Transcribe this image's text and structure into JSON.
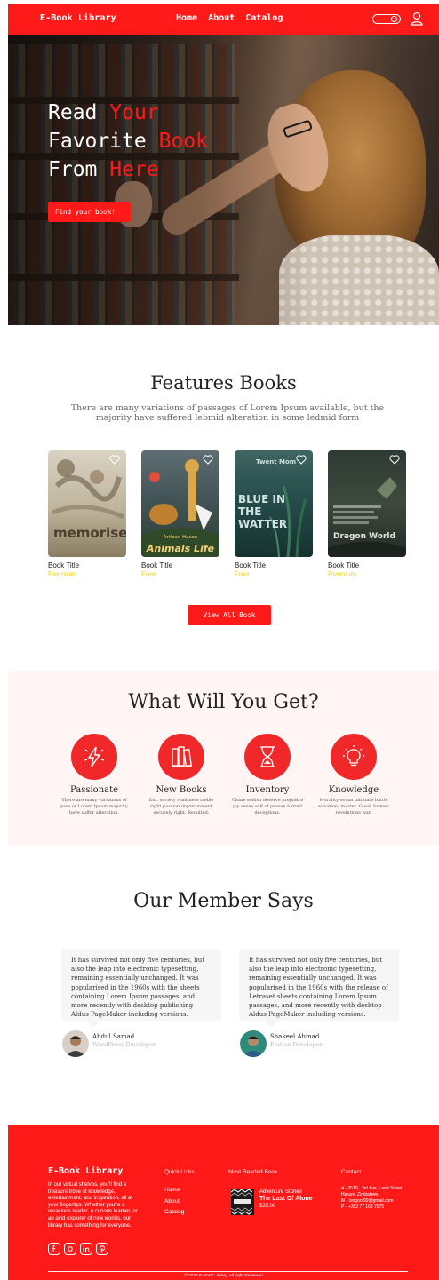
{
  "nav": {
    "brand": "E-Book Library",
    "links": [
      "Home",
      "About",
      "Catalog"
    ]
  },
  "hero": {
    "line1_a": "Read ",
    "line1_b": "Your",
    "line2_a": "Favorite ",
    "line2_b": "Book",
    "line3_a": "From ",
    "line3_b": "Here",
    "cta": "Find your book!"
  },
  "features": {
    "title": "Features Books",
    "subtitle": "There are many variations of passages of Lorem Ipsum available, but the majority have suffered lebmid alteration in some ledmid form",
    "books": [
      {
        "title": "Book Title",
        "price": "Premium",
        "cover_text": "memorise"
      },
      {
        "title": "Book Title",
        "price": "Free",
        "cover_author": "Arifean Hasan",
        "cover_text": "Animals Life"
      },
      {
        "title": "Book Title",
        "price": "Free",
        "cover_top": "Twent Mom",
        "cover_text": "BLUE IN THE WATTER"
      },
      {
        "title": "Book Title",
        "price": "Premium",
        "cover_text": "Dragon World"
      }
    ],
    "view_all": "View All Book"
  },
  "get": {
    "title": "What Will You Get?",
    "items": [
      {
        "name": "Passionate",
        "desc": "There are many variations of pass of Lorem Ipsum majority have suffer alteration.",
        "icon": "lightning-icon"
      },
      {
        "name": "New Books",
        "desc": "Dat. society readiness treble right passion imprisonment securely right. Reoulted.",
        "icon": "books-icon"
      },
      {
        "name": "Inventory",
        "desc": "Chase selfish deserve prejudice joy sense self of proven hatred deceptions.",
        "icon": "hourglass-icon"
      },
      {
        "name": "Knowledge",
        "desc": "Morality ocean ultimate battle salvation. master. Good. former. revelations war.",
        "icon": "lightbulb-icon"
      }
    ]
  },
  "members": {
    "title": "Our Member Says",
    "quotes": [
      {
        "text": "It has survived not only five centuries, but also the leap into electronic typesetting, remaining essentially unchanged. It was popularised in the 1960s with the sheets containing Lorem Ipsum passages, and more recently with desktop publishing Aldus PageMaker including versions.",
        "name": "Abdul Samad",
        "role": "WordPress Developer"
      },
      {
        "text": "It has survived not only five centuries, but also the leap into electronic typesetting, remaining essentially unchanged. It was popularised in the 1960s with the release of Letraset sheets containing Lorem Ipsum passages, and more recently with desktop Aldus PageMaker including versions.",
        "name": "Shakeel Ahmad",
        "role": "Flutter Developer"
      }
    ]
  },
  "footer": {
    "brand": "E-Book Library",
    "about": "In our virtual shelves, you'll find a treasure trove of knowledge, entertainment, and inspiration, all at your fingertips. Whether you're a voracious reader, a curious learner, or an avid explorer of new worlds, our library has something for everyone.",
    "quick_links_head": "Quick Links",
    "quick_links": [
      "Home",
      "About",
      "Catalog"
    ],
    "most_read_head": "Most Readed Book",
    "book_genre": "Adventure Stories",
    "book_title": "The Last Of Alone",
    "book_price": "$35.00",
    "contact_head": "Contact",
    "contact_lines": [
      "A - 2519 , 3rd Ave, Land Street,",
      "Harare, Zimbabwe.",
      "M - bingoof99@gmail.com",
      "P - +263 77 168 7075"
    ],
    "copyright": "© 2024 E-Book Library. All right Reserved"
  }
}
